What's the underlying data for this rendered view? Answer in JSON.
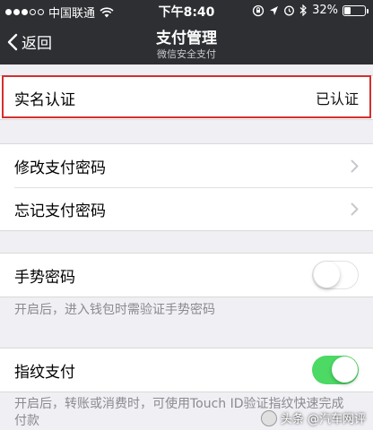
{
  "status_bar": {
    "carrier": "中国联通",
    "time": "下午8:40",
    "battery": "32%",
    "battery_level": 0.32
  },
  "nav": {
    "back_label": "返回",
    "title": "支付管理",
    "subtitle": "微信安全支付"
  },
  "verification": {
    "label": "实名认证",
    "status": "已认证"
  },
  "password_group": {
    "items": [
      {
        "label": "修改支付密码"
      },
      {
        "label": "忘记支付密码"
      }
    ]
  },
  "gesture": {
    "label": "手势密码",
    "enabled": false,
    "note": "开启后，进入钱包时需验证手势密码"
  },
  "fingerprint": {
    "label": "指纹支付",
    "enabled": true,
    "note": "开启后，转账或消费时，可使用Touch ID验证指纹快速完成付款"
  },
  "watermark": {
    "text": "头条 @汽车网评"
  },
  "colors": {
    "nav_bg": "#2e2f33",
    "toggle_on": "#4cd964",
    "highlight": "#d32f2f",
    "page_bg": "#efeff4"
  }
}
